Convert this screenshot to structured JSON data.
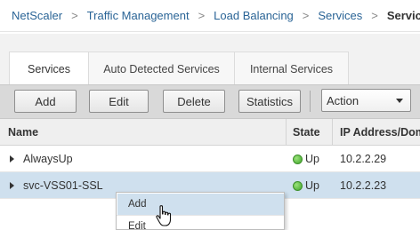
{
  "breadcrumb": {
    "items": [
      "NetScaler",
      "Traffic Management",
      "Load Balancing",
      "Services",
      "Services"
    ],
    "separator": ">"
  },
  "tabs": [
    {
      "label": "Services",
      "active": true
    },
    {
      "label": "Auto Detected Services",
      "active": false
    },
    {
      "label": "Internal Services",
      "active": false
    }
  ],
  "toolbar": {
    "add_label": "Add",
    "edit_label": "Edit",
    "delete_label": "Delete",
    "statistics_label": "Statistics",
    "action_label": "Action"
  },
  "table": {
    "columns": [
      "Name",
      "State",
      "IP Address/Dom"
    ],
    "rows": [
      {
        "name": "AlwaysUp",
        "state": "Up",
        "ip": "10.2.2.29",
        "selected": false
      },
      {
        "name": "svc-VSS01-SSL",
        "state": "Up",
        "ip": "10.2.2.23",
        "selected": true
      }
    ]
  },
  "context_menu": {
    "items": [
      {
        "label": "Add",
        "highlighted": true
      },
      {
        "label": "Edit",
        "highlighted": false
      }
    ]
  },
  "colors": {
    "selected_row": "#cfe0ee",
    "status_up": "#3fa528",
    "link": "#2a6496"
  }
}
